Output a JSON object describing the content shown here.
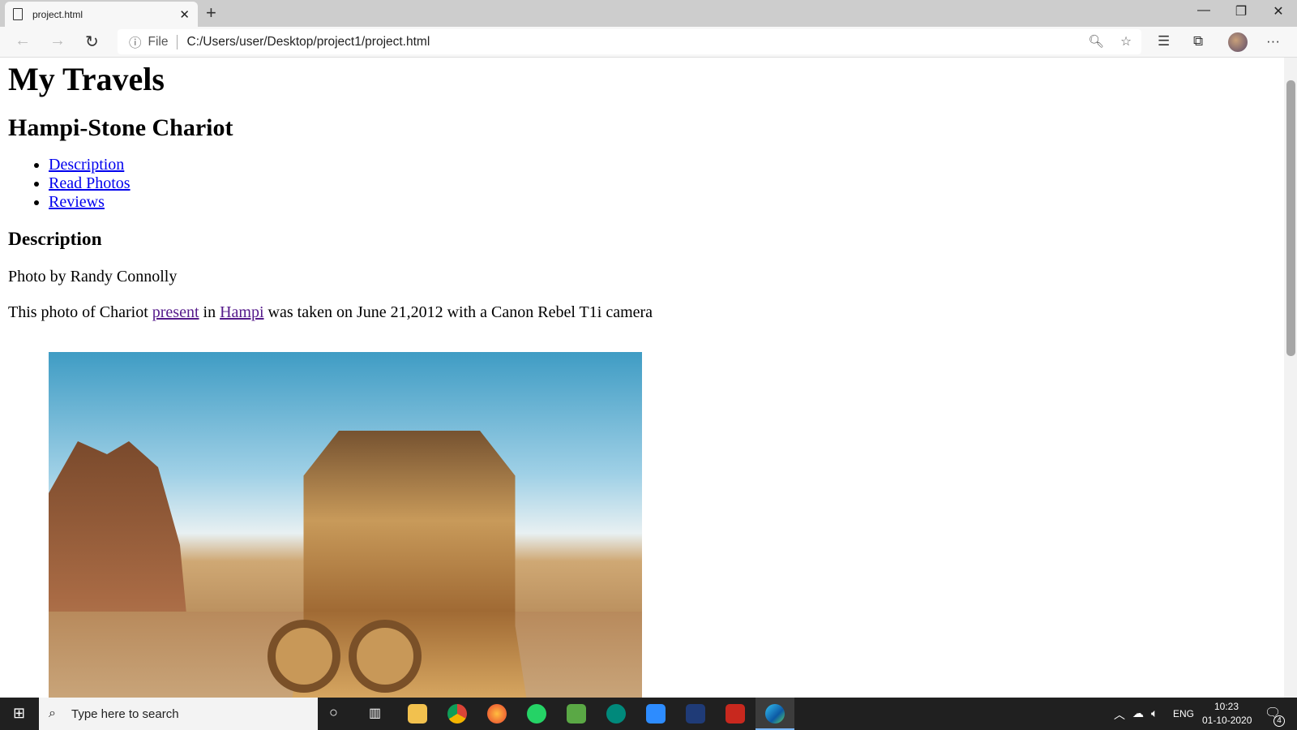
{
  "browser": {
    "tab_title": "project.html",
    "address_prefix": "File",
    "url": "C:/Users/user/Desktop/project1/project.html"
  },
  "page": {
    "h1": "My Travels",
    "h2": "Hampi-Stone Chariot",
    "links": [
      "Description",
      "Read Photos",
      "Reviews"
    ],
    "h3": "Description",
    "credit": "Photo by Randy Connolly",
    "sentence": {
      "a": "This photo of Chariot ",
      "link1": "present",
      "b": " in ",
      "link2": "Hampi",
      "c": " was taken on June 21,2012 with a Canon Rebel T1i camera"
    }
  },
  "taskbar": {
    "search_placeholder": "Type here to search",
    "lang": "ENG",
    "time": "10:23",
    "date": "01-10-2020",
    "notifications": "4"
  }
}
